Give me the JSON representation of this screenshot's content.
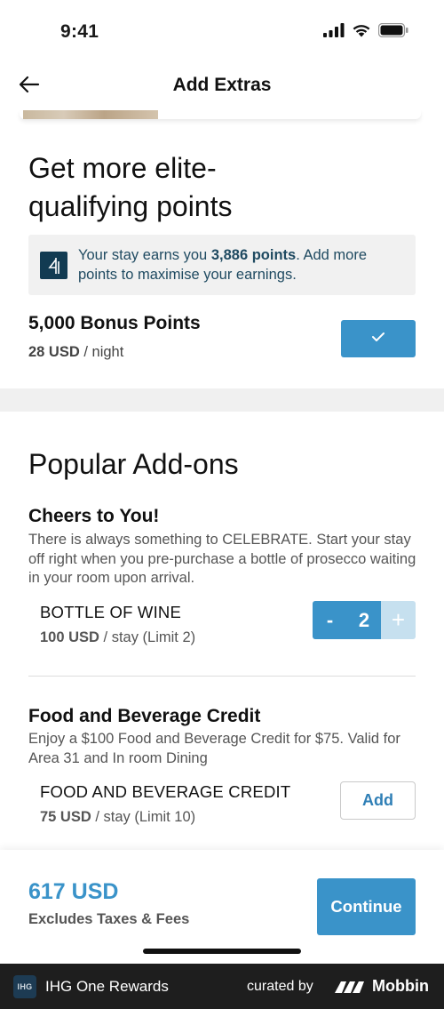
{
  "status_bar": {
    "time": "9:41"
  },
  "nav": {
    "title": "Add Extras"
  },
  "elite": {
    "heading": "Get more elite-qualifying points",
    "info_prefix": "Your stay earns you ",
    "info_points": "3,886 points",
    "info_suffix": ". Add more points to maximise your earnings.",
    "bonus_title": "5,000 Bonus Points",
    "bonus_price": "28 USD",
    "bonus_unit": " / night",
    "bonus_selected": true
  },
  "popular": {
    "heading": "Popular Add-ons",
    "addons": [
      {
        "title": "Cheers to You!",
        "description": "There is always something to CELEBRATE. Start your stay off right when you pre-purchase a bottle of prosecco waiting in your room upon arrival.",
        "item_name": "BOTTLE OF WINE",
        "price": "100 USD",
        "unit": " / stay (Limit 2)",
        "quantity": "2",
        "minus_label": "-",
        "plus_label": "+"
      },
      {
        "title": "Food and Beverage Credit",
        "description": "Enjoy a $100 Food and Beverage Credit for $75. Valid for Area 31 and In room Dining",
        "item_name": "FOOD AND BEVERAGE CREDIT",
        "price": "75 USD",
        "unit": " / stay (Limit 10)",
        "add_label": "Add"
      }
    ]
  },
  "footer": {
    "total": "617 USD",
    "note": "Excludes Taxes & Fees",
    "continue_label": "Continue"
  },
  "brand_bar": {
    "logo_text": "IHG",
    "app_name": "IHG One Rewards",
    "curated_by": "curated by",
    "mobbin": "Mobbin"
  },
  "colors": {
    "accent": "#3a93c9",
    "accent_light": "#c6e0ef",
    "info_text": "#1f4a61",
    "info_icon_bg": "#123b52"
  },
  "icons": [
    "back-arrow-icon",
    "signal-icon",
    "wifi-icon",
    "battery-icon",
    "checkmark-icon",
    "ihg-card-icon",
    "mobbin-logo-icon"
  ]
}
